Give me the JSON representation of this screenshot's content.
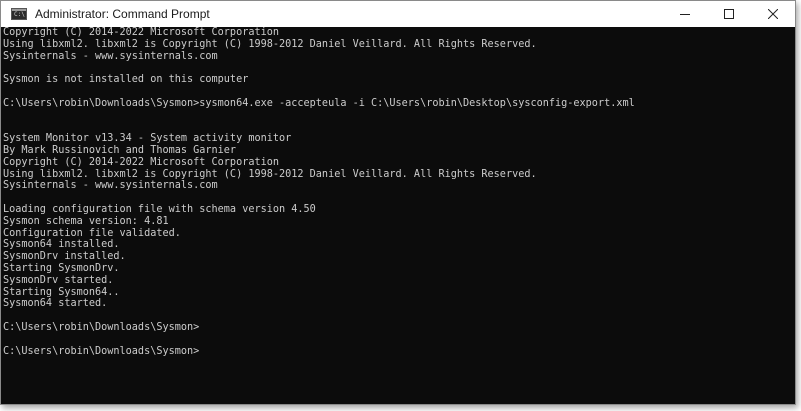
{
  "window": {
    "title": "Administrator: Command Prompt",
    "icon_label": "C:\\",
    "icon": "command-prompt-icon",
    "controls": {
      "minimize_icon": "minimize-icon",
      "maximize_icon": "maximize-icon",
      "close_icon": "close-icon"
    }
  },
  "colors": {
    "console_background": "#0c0c0c",
    "console_text": "#cccccc",
    "titlebar_background": "#ffffff"
  },
  "console": {
    "lines": [
      "Copyright (C) 2014-2022 Microsoft Corporation",
      "Using libxml2. libxml2 is Copyright (C) 1998-2012 Daniel Veillard. All Rights Reserved.",
      "Sysinternals - www.sysinternals.com",
      "",
      "Sysmon is not installed on this computer",
      "",
      "C:\\Users\\robin\\Downloads\\Sysmon>sysmon64.exe -accepteula -i C:\\Users\\robin\\Desktop\\sysconfig-export.xml",
      "",
      "",
      "System Monitor v13.34 - System activity monitor",
      "By Mark Russinovich and Thomas Garnier",
      "Copyright (C) 2014-2022 Microsoft Corporation",
      "Using libxml2. libxml2 is Copyright (C) 1998-2012 Daniel Veillard. All Rights Reserved.",
      "Sysinternals - www.sysinternals.com",
      "",
      "Loading configuration file with schema version 4.50",
      "Sysmon schema version: 4.81",
      "Configuration file validated.",
      "Sysmon64 installed.",
      "SysmonDrv installed.",
      "Starting SysmonDrv.",
      "SysmonDrv started.",
      "Starting Sysmon64..",
      "Sysmon64 started.",
      "",
      "C:\\Users\\robin\\Downloads\\Sysmon>",
      "",
      "C:\\Users\\robin\\Downloads\\Sysmon>"
    ]
  }
}
